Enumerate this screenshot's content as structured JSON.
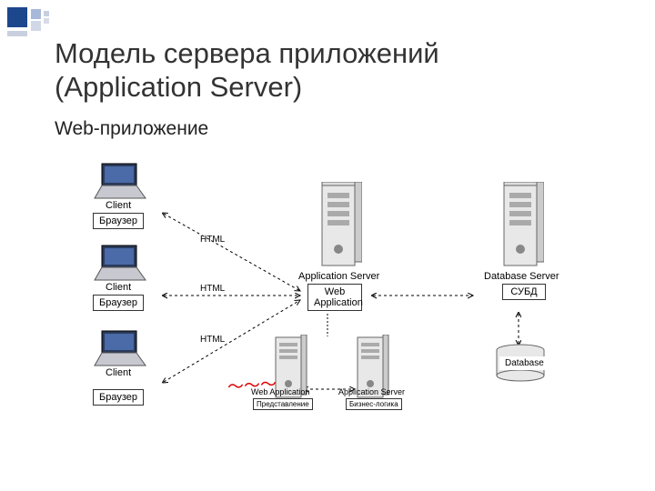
{
  "title_line1": "Модель сервера приложений",
  "title_line2": "(Application Server)",
  "subtitle": "Web-приложение",
  "clients": [
    {
      "label": "Client",
      "browser": "Браузер"
    },
    {
      "label": "Client",
      "browser": "Браузер"
    },
    {
      "label": "Client",
      "browser": "Браузер"
    }
  ],
  "arrow_html": "HTML",
  "app_server": {
    "title": "Application Server",
    "web_app": "Web Application"
  },
  "db_server": {
    "title": "Database Server",
    "subd": "СУБД",
    "db": "Database"
  },
  "split": {
    "web_app2": "Web Application",
    "present": "Представление",
    "app_server2": "Application Server",
    "biz": "Бизнес-логика"
  }
}
